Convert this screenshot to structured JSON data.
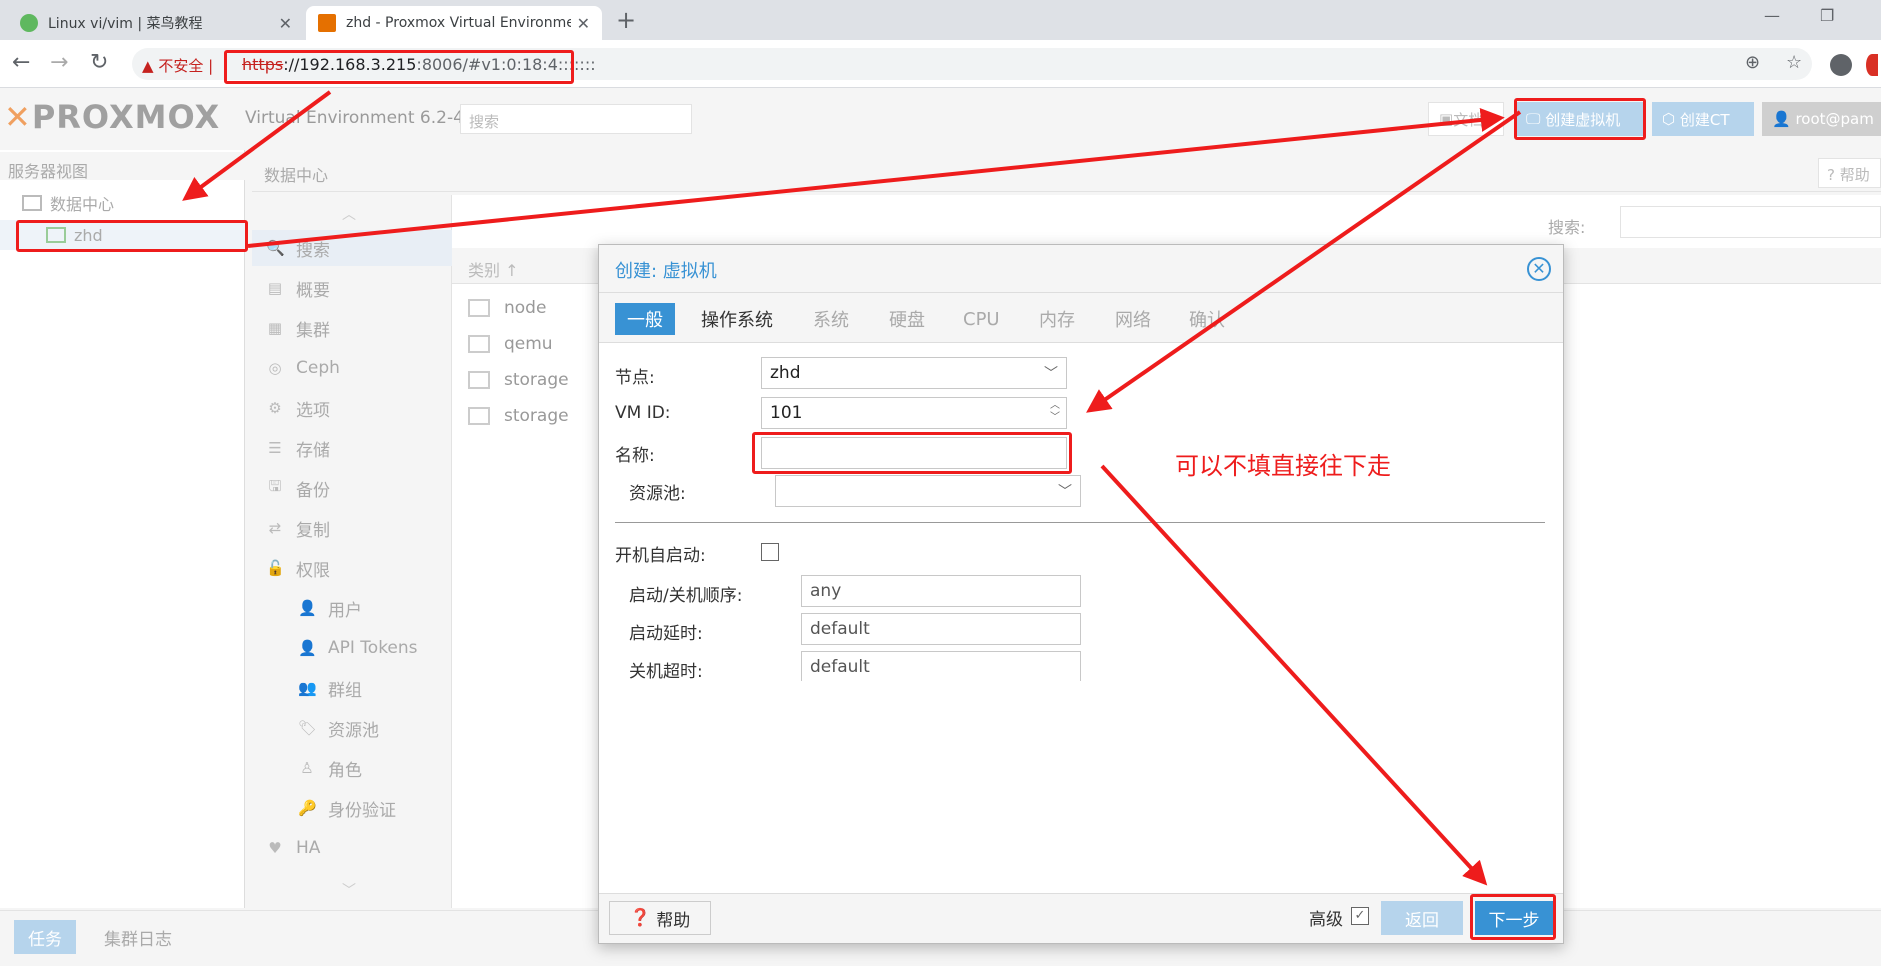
{
  "browser": {
    "tabs": [
      {
        "title": "Linux vi/vim | 菜鸟教程",
        "close": "✕"
      },
      {
        "title": "zhd - Proxmox Virtual Environment",
        "close": "✕"
      }
    ],
    "new_tab": "+",
    "window_controls": [
      "—",
      "❐"
    ],
    "security_label": "不安全",
    "url_scheme": "https",
    "url_host": "://192.168.3.215",
    "url_rest": ":8006/#v1:0:18:4:::::::",
    "toolbar_icons": [
      "zoom-icon",
      "star-icon",
      "account-icon"
    ]
  },
  "pve": {
    "logo": {
      "x": "✕",
      "text": "PROXMOX"
    },
    "version": "Virtual Environment 6.2-4",
    "search_placeholder": "搜索",
    "doc_button": "文档",
    "create_vm": "创建虚拟机",
    "create_ct": "创建CT",
    "user": "root@pam",
    "tree_header": "服务器视图",
    "tree": [
      {
        "label": "数据中心",
        "icon": "datacenter-icon"
      },
      {
        "label": "zhd",
        "icon": "node-icon"
      }
    ],
    "dc_title": "数据中心",
    "help": "帮助",
    "menu": [
      {
        "label": "搜索",
        "icon": "🔍",
        "sub": false
      },
      {
        "label": "概要",
        "icon": "▤",
        "sub": false
      },
      {
        "label": "集群",
        "icon": "▦",
        "sub": false
      },
      {
        "label": "Ceph",
        "icon": "◎",
        "sub": false
      },
      {
        "label": "选项",
        "icon": "⚙",
        "sub": false
      },
      {
        "label": "存储",
        "icon": "☰",
        "sub": false
      },
      {
        "label": "备份",
        "icon": "🖫",
        "sub": false
      },
      {
        "label": "复制",
        "icon": "⇄",
        "sub": false
      },
      {
        "label": "权限",
        "icon": "🔓",
        "sub": false
      },
      {
        "label": "用户",
        "icon": "👤",
        "sub": true
      },
      {
        "label": "API Tokens",
        "icon": "👤",
        "sub": true
      },
      {
        "label": "群组",
        "icon": "👥",
        "sub": true
      },
      {
        "label": "资源池",
        "icon": "🏷",
        "sub": true
      },
      {
        "label": "角色",
        "icon": "♙",
        "sub": true
      },
      {
        "label": "身份验证",
        "icon": "🔑",
        "sub": true
      },
      {
        "label": "HA",
        "icon": "♥",
        "sub": false
      }
    ],
    "grid_search_label": "搜索:",
    "grid_column": "类别 ↑",
    "grid_rows": [
      "node",
      "qemu",
      "storage",
      "storage"
    ],
    "bottom_tabs": [
      "任务",
      "集群日志"
    ]
  },
  "dialog": {
    "title": "创建: 虚拟机",
    "close": "✕",
    "tabs": [
      {
        "label": "一般",
        "state": "active"
      },
      {
        "label": "操作系统",
        "state": "available"
      },
      {
        "label": "系统",
        "state": "disabled"
      },
      {
        "label": "硬盘",
        "state": "disabled"
      },
      {
        "label": "CPU",
        "state": "disabled"
      },
      {
        "label": "内存",
        "state": "disabled"
      },
      {
        "label": "网络",
        "state": "disabled"
      },
      {
        "label": "确认",
        "state": "disabled"
      }
    ],
    "fields": {
      "node_label": "节点:",
      "node_value": "zhd",
      "vmid_label": "VM ID:",
      "vmid_value": "101",
      "name_label": "名称:",
      "name_value": "",
      "pool_label": "资源池:",
      "pool_value": "",
      "autostart_label": "开机自启动:",
      "order_label": "启动/关机顺序:",
      "order_value": "any",
      "delay_label": "启动延时:",
      "delay_value": "default",
      "timeout_label": "关机超时:",
      "timeout_value": "default"
    },
    "footer": {
      "help": "帮助",
      "advanced": "高级",
      "advanced_checked": true,
      "back": "返回",
      "next": "下一步"
    }
  },
  "annotation": {
    "note": "可以不填直接往下走",
    "color": "#ee1c1c"
  },
  "colors": {
    "accent": "#3892d4",
    "accent_light": "#b6d4ec"
  }
}
